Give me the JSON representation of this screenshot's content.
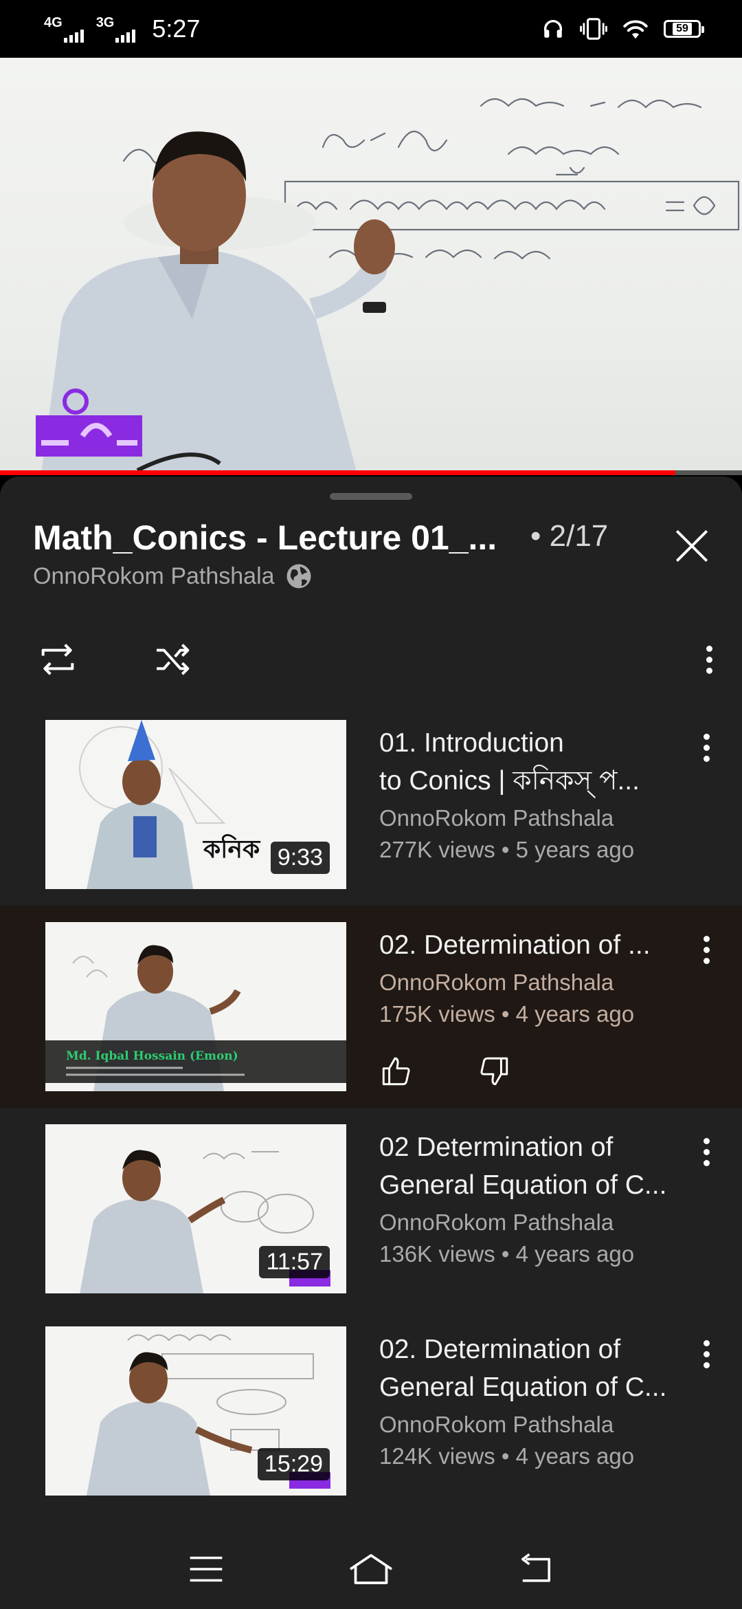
{
  "status_bar": {
    "network1": "4G",
    "network2": "3G",
    "time": "5:27",
    "battery": "59"
  },
  "player": {
    "progress_fraction": 0.91
  },
  "playlist": {
    "title": "Math_Conics - Lecture 01_...",
    "index": "• 2/17",
    "channel": "OnnoRokom Pathshala"
  },
  "items": [
    {
      "title_line1": "01. Introduction",
      "title_line2": "to Conics | কনিকস্‌ প...",
      "channel": "OnnoRokom Pathshala",
      "stats": "277K views • 5 years ago",
      "duration": "9:33"
    },
    {
      "title_line1": "02. Determination of ...",
      "title_line2": "",
      "channel": "OnnoRokom Pathshala",
      "stats": "175K views • 4 years ago",
      "duration": "",
      "thumb_caption": "Md. Iqbal Hossain (Emon)"
    },
    {
      "title_line1": "02  Determination of",
      "title_line2": "General Equation of C...",
      "channel": "OnnoRokom Pathshala",
      "stats": "136K views • 4 years ago",
      "duration": "11:57"
    },
    {
      "title_line1": "02. Determination of",
      "title_line2": "General Equation of C...",
      "channel": "OnnoRokom Pathshala",
      "stats": "124K views • 4 years ago",
      "duration": "15:29"
    }
  ],
  "colors": {
    "sheet_bg": "#212121",
    "active_row_bg": "#1f1814",
    "progress": "#ff0000"
  },
  "icons": [
    "headphones-icon",
    "vibrate-icon",
    "wifi-icon",
    "close-icon",
    "loop-icon",
    "shuffle-icon",
    "more-vert-icon",
    "like-icon",
    "dislike-icon",
    "menu-icon",
    "home-icon",
    "back-icon"
  ]
}
